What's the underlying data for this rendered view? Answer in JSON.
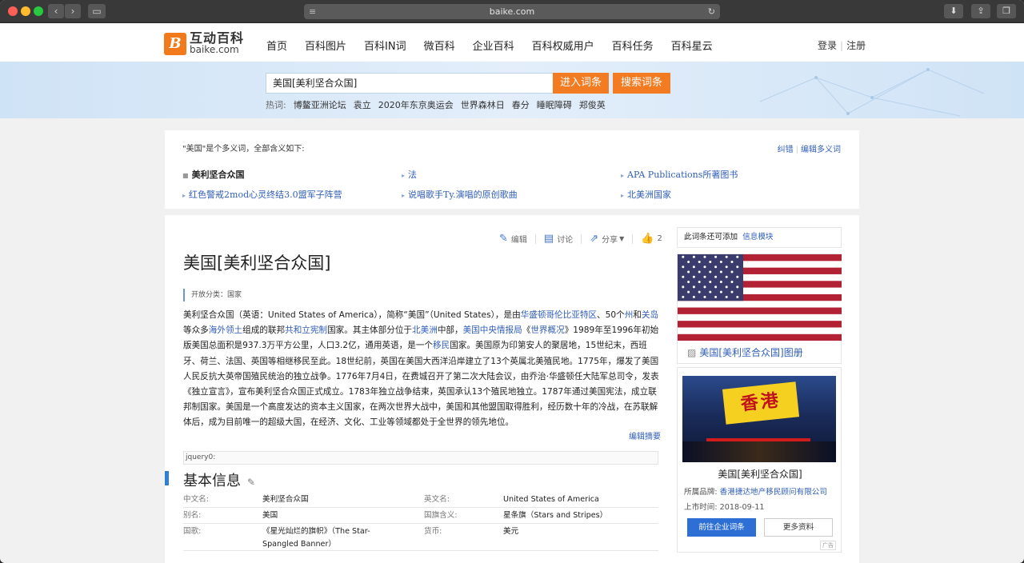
{
  "browser": {
    "url": "baike.com"
  },
  "logo": {
    "cn": "互动百科",
    "en": "baike.com",
    "mark": "B"
  },
  "nav": [
    "首页",
    "百科图片",
    "百科IN词",
    "微百科",
    "企业百科",
    "百科权威用户",
    "百科任务",
    "百科星云"
  ],
  "auth": {
    "login": "登录",
    "register": "注册"
  },
  "search": {
    "value": "美国[美利坚合众国]",
    "enter_label": "进入词条",
    "search_label": "搜索词条",
    "hot_label": "热词:",
    "hot_words": [
      "博鳌亚洲论坛",
      "袁立",
      "2020年东京奥运会",
      "世界森林日",
      "春分",
      "睡眠障碍",
      "郑俊英"
    ]
  },
  "disambiguation": {
    "heading": "\"美国\"是个多义词，全部含义如下:",
    "correct": "纠错",
    "edit_multi": "编辑多义词",
    "items": [
      "美利坚合众国",
      "法",
      "APA Publications所著图书",
      "红色警戒2mod心灵终结3.0盟军子阵营",
      "说唱歌手Ty.演唱的原创歌曲",
      "北美洲国家"
    ]
  },
  "toolbar": {
    "edit": "编辑",
    "discuss": "讨论",
    "share": "分享",
    "likes": "2"
  },
  "article": {
    "title": "美国[美利坚合众国]",
    "category": "开放分类：国家",
    "paragraph": [
      {
        "t": "美利坚合众国（英语：United States of America），简称“美国”（United States），是由"
      },
      {
        "t": "华盛顿哥伦比亚特区",
        "link": true
      },
      {
        "t": "、50个"
      },
      {
        "t": "州",
        "link": true
      },
      {
        "t": "和"
      },
      {
        "t": "关岛",
        "link": true
      },
      {
        "t": "等众多"
      },
      {
        "t": "海外领土",
        "link": true
      },
      {
        "t": "组成的联邦"
      },
      {
        "t": "共和立宪制",
        "link": true
      },
      {
        "t": "国家。其主体部分位于"
      },
      {
        "t": "北美洲",
        "link": true
      },
      {
        "t": "中部，"
      },
      {
        "t": "美国中央情报局",
        "link": true
      },
      {
        "t": "《"
      },
      {
        "t": "世界概况",
        "link": true
      },
      {
        "t": "》1989年至1996年初始版美国总面积是937.3万平方公里，人口3.2亿，通用英语，是一个"
      },
      {
        "t": "移民",
        "link": true
      },
      {
        "t": "国家。美国原为印第安人的聚居地，15世纪末，西班牙、荷兰、法国、英国等相继移民至此。18世纪前，英国在美国大西洋沿岸建立了13个英属北美殖民地。1775年，爆发了美国人民反抗大英帝国殖民统治的独立战争。1776年7月4日，在费城召开了第二次大陆会议，由乔治·华盛顿任大陆军总司令，发表《独立宣言》，宣布美利坚合众国正式成立。1783年独立战争结束，英国承认13个殖民地独立。1787年通过美国宪法，成立联邦制国家。美国是一个高度发达的资本主义国家，在两次世界大战中，美国和其他盟国取得胜利，经历数十年的冷战，在苏联解体后，成为目前唯一的超级大国，在经济、文化、工业等领域都处于全世界的领先地位。"
      }
    ],
    "edit_summary": "编辑摘要",
    "subbar_text": "jquery0:",
    "basic_title": "基本信息",
    "info": [
      {
        "k1": "中文名:",
        "v1": "美利坚合众国",
        "k2": "英文名:",
        "v2": "United States of America"
      },
      {
        "k1": "别名:",
        "v1": "美国",
        "k2": "国旗含义:",
        "v2": "星条旗（Stars and Stripes）"
      },
      {
        "k1": "国歌:",
        "v1": "《星光灿烂的旗帜》（The Star-Spangled Banner）",
        "k2": "货币:",
        "v2": "美元"
      }
    ]
  },
  "sidebar": {
    "add_label": "此词条还可添加",
    "add_link": "信息模块",
    "gallery_link": "美国[美利坚合众国]图册",
    "ad": {
      "banner_title": "香港",
      "title": "美国[美利坚合众国]",
      "brand_label": "所属品牌:",
      "brand_name": "香港捷达地产移民顾问有限公司",
      "date_label": "上市时间:",
      "date": "2018-09-11",
      "btn_primary": "前往企业词条",
      "btn_secondary": "更多资料",
      "tag": "广告"
    }
  },
  "colors": {
    "accent": "#f37c22",
    "link": "#2f5eb8",
    "primary_btn": "#2e6fd6"
  }
}
